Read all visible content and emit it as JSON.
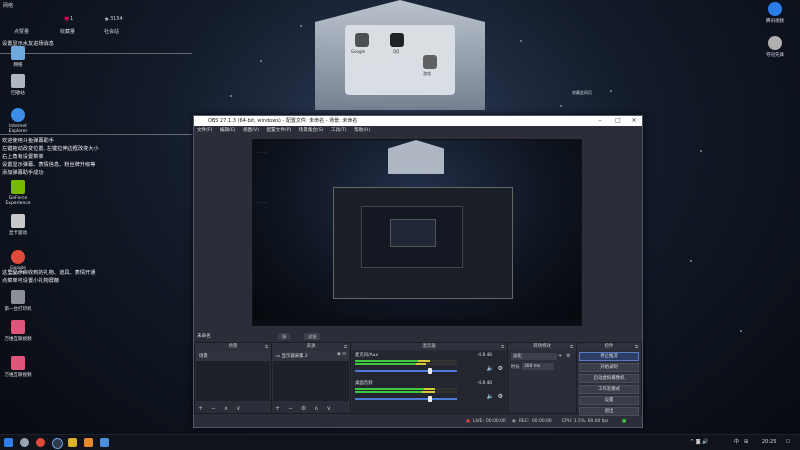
{
  "desktop": {
    "top_labels": [
      "网络",
      "请求数",
      "回收站"
    ],
    "top_counts": [
      "1",
      "1",
      "3154"
    ],
    "widget_labels": [
      "点赞量",
      "收藏量",
      "社会站"
    ],
    "overlay_lines_top": [
      "设置显示水友进场消息"
    ],
    "overlay_lines_mid": [
      "欢迎使用斗鱼弹幕助手",
      "左键拖动改变位置, 左键拉伸边框改变大小",
      "右上角有设置菜单",
      "设置显示弹幕、表情信息、粉丝牌升级等",
      "添加弹幕助手成功"
    ],
    "overlay_lines_low": [
      "这里显示你收到的礼物、道具、表情开通",
      "点菜单可设置小礼物屏蔽"
    ],
    "icons": [
      {
        "label": "网络",
        "color": "#6fa8dc"
      },
      {
        "label": "回收站",
        "color": "#b0b7c2"
      },
      {
        "label": "Internet Explorer",
        "color": "#3d8ee6"
      },
      {
        "label": "GeForce Experience",
        "color": "#76b900"
      },
      {
        "label": "显卡驱动",
        "color": "#c9c9c9"
      },
      {
        "label": "Google Chrome",
        "color": "#e04a3a"
      },
      {
        "label": "第一台打印机",
        "color": "#8b8f98"
      },
      {
        "label": "万维互联视频",
        "color": "#e0567a"
      },
      {
        "label": "万维互联视频",
        "color": "#e0567a"
      }
    ],
    "right_widgets": [
      {
        "label": "腾讯视频",
        "color": "#2b7de9"
      },
      {
        "label": "夺冠先锋",
        "color": "#b0b0b0"
      }
    ],
    "house": {
      "items": [
        "Google",
        "QQ",
        "游戏"
      ],
      "right_label": "收藏此网页"
    }
  },
  "obs": {
    "title": "OBS 27.1.3 (64-bit, windows) - 配置文件: 未命名 - 场景: 未命名",
    "menu": [
      "文件(F)",
      "编辑(E)",
      "视图(V)",
      "配置文件(P)",
      "场景集合(S)",
      "工具(T)",
      "帮助(H)"
    ],
    "scene_current": "未命名",
    "scene_pills": [
      "源",
      "滤镜"
    ],
    "docks": {
      "scenes": {
        "header": "场景",
        "items": [
          "场景"
        ]
      },
      "sources": {
        "header": "来源",
        "items": [
          "显示器采集 2"
        ]
      },
      "mixer": {
        "header": "混音器",
        "tracks": [
          {
            "name": "麦克风/Aux",
            "db": "-4.8 dB",
            "level": 0.62,
            "fader": 0.72
          },
          {
            "name": "桌面音频",
            "db": "-4.8 dB",
            "level": 0.7,
            "fader": 0.72
          }
        ]
      },
      "transitions": {
        "header": "转场特效",
        "type": "淡化",
        "duration_label": "时长",
        "duration": "300 ms"
      },
      "controls": {
        "header": "控件",
        "buttons": [
          "停止推流",
          "开始录制",
          "启动虚拟摄像机",
          "工作室模式",
          "设置",
          "退出"
        ],
        "active": 0
      }
    },
    "status": {
      "live_label": "LIVE:",
      "live_time": "00:00:00",
      "rec_label": "REC:",
      "rec_time": "00:00:00",
      "cpu": "CPU: 1.5%, 60.00 fps"
    }
  },
  "taskbar": {
    "clock": "20:25",
    "ime": "中",
    "apps": [
      {
        "name": "start",
        "color": "#2f80ed"
      },
      {
        "name": "search",
        "color": "#9aa3b2"
      },
      {
        "name": "chrome",
        "color": "#e04a3a"
      },
      {
        "name": "obs",
        "color": "#333a48"
      },
      {
        "name": "app-yellow",
        "color": "#d9b12d"
      },
      {
        "name": "app-orange",
        "color": "#e58b2b"
      },
      {
        "name": "app-blue",
        "color": "#4a8fe0"
      }
    ]
  }
}
